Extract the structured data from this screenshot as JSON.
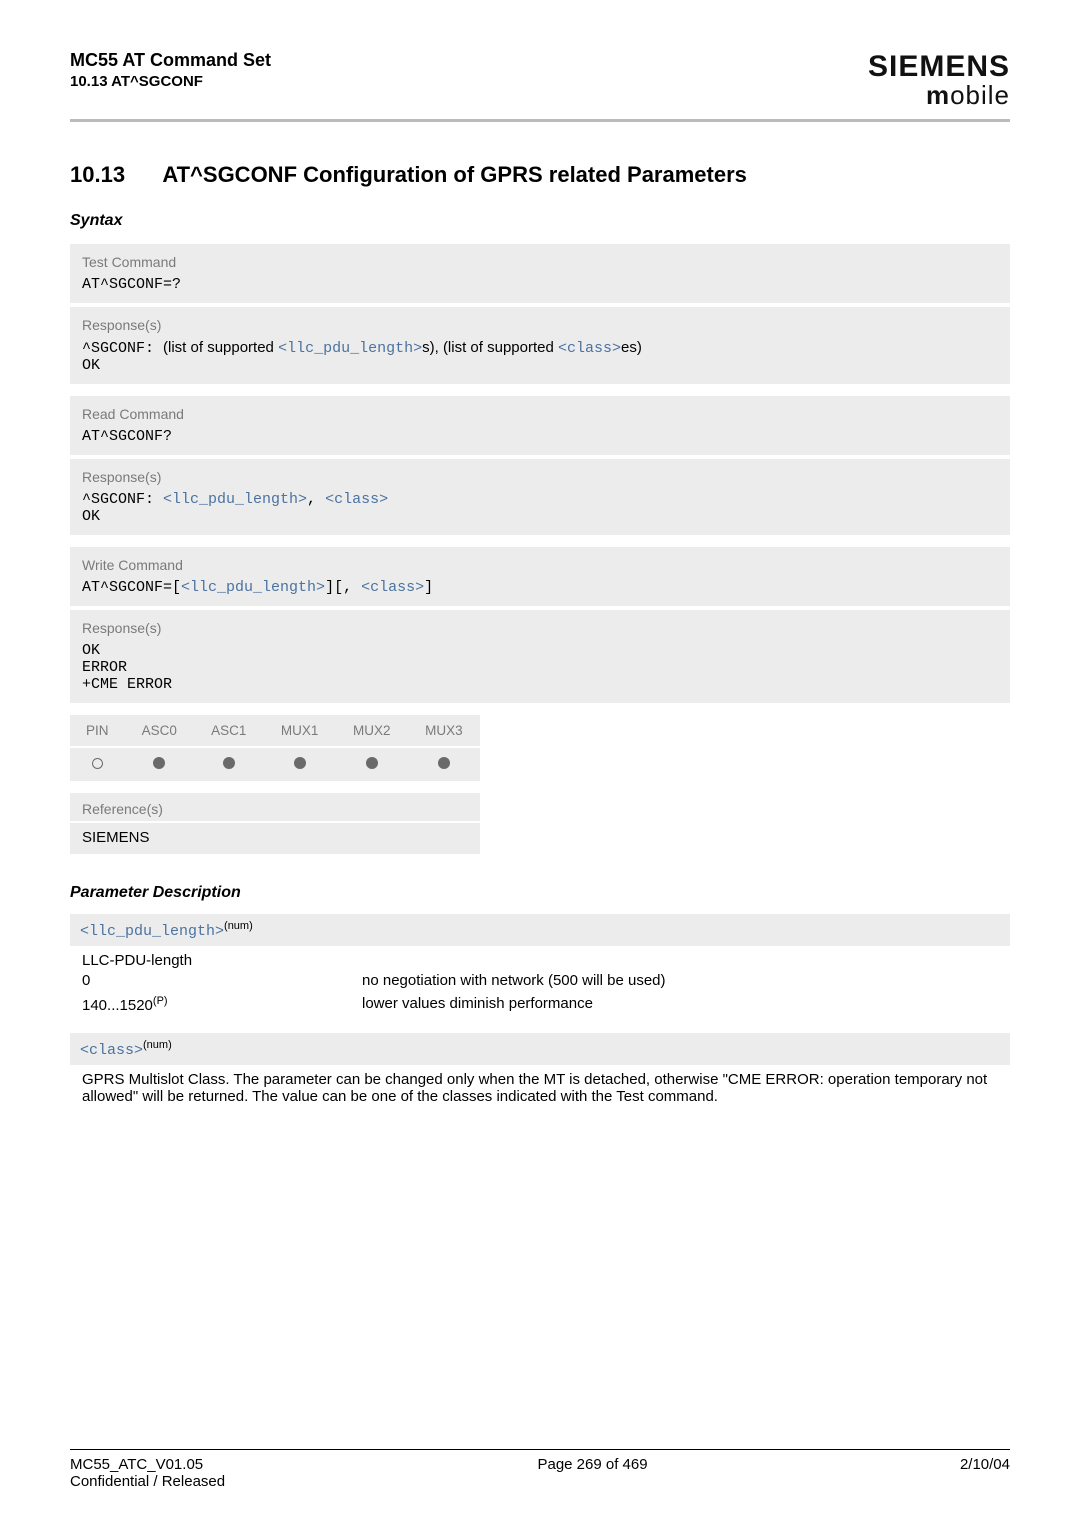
{
  "header": {
    "title": "MC55 AT Command Set",
    "subtitle": "10.13 AT^SGCONF",
    "brand_main": "SIEMENS",
    "brand_sub_m": "m",
    "brand_sub_rest": "obile"
  },
  "section": {
    "number": "10.13",
    "title": "AT^SGCONF   Configuration of GPRS related Parameters"
  },
  "syntax_label": "Syntax",
  "test_cmd": {
    "label": "Test Command",
    "cmd": "AT^SGCONF=?",
    "resp_label": "Response(s)",
    "resp_prefix": "^SGCONF: ",
    "resp_mid1": "(list of supported ",
    "resp_key1": "<llc_pdu_length>",
    "resp_mid2": "s), (list of supported ",
    "resp_key2": "<class>",
    "resp_end": "es)",
    "ok": "OK"
  },
  "read_cmd": {
    "label": "Read Command",
    "cmd": "AT^SGCONF?",
    "resp_label": "Response(s)",
    "resp_prefix": "^SGCONF: ",
    "key1": "<llc_pdu_length>",
    "sep": ", ",
    "key2": "<class>",
    "ok": "OK"
  },
  "write_cmd": {
    "label": "Write Command",
    "cmd_prefix": "AT^SGCONF=[",
    "key1": "<llc_pdu_length>",
    "mid": "][, ",
    "key2": "<class>",
    "end": "]",
    "resp_label": "Response(s)",
    "ok": "OK",
    "error": "ERROR",
    "cme": "+CME ERROR"
  },
  "mux": {
    "cols": [
      "PIN",
      "ASC0",
      "ASC1",
      "MUX1",
      "MUX2",
      "MUX3"
    ],
    "vals": [
      "empty",
      "filled",
      "filled",
      "filled",
      "filled",
      "filled"
    ]
  },
  "reference": {
    "label": "Reference(s)",
    "value": "SIEMENS"
  },
  "param_desc_label": "Parameter Description",
  "param1": {
    "name": "<llc_pdu_length>",
    "sup": "(num)",
    "desc_title": "LLC-PDU-length",
    "rows": [
      {
        "c1": "0",
        "c2": "no negotiation with network (500 will be used)"
      },
      {
        "c1": "140...1520",
        "c1sup": "(P)",
        "c2": "lower values diminish performance"
      }
    ]
  },
  "param2": {
    "name": "<class>",
    "sup": "(num)",
    "desc": "GPRS Multislot Class. The parameter can be changed only when the MT is detached, otherwise \"CME ERROR: operation temporary not allowed\" will be returned. The value can be one of the classes indicated with the Test command."
  },
  "footer": {
    "left1": "MC55_ATC_V01.05",
    "left2": "Confidential / Released",
    "center": "Page 269 of 469",
    "right": "2/10/04"
  }
}
